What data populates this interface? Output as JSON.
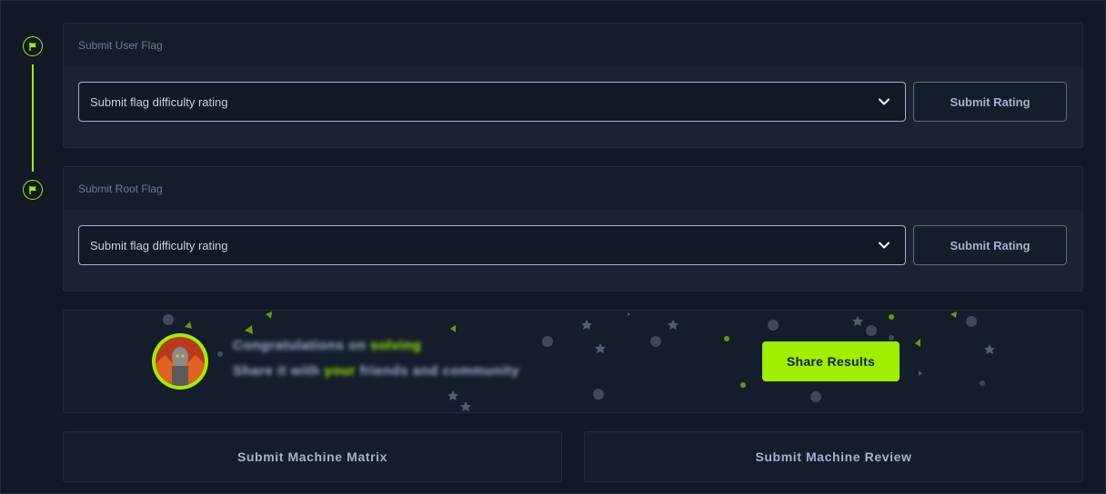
{
  "user_flag": {
    "title": "Submit User Flag",
    "select_value": "Submit flag difficulty rating",
    "submit_label": "Submit Rating"
  },
  "root_flag": {
    "title": "Submit Root Flag",
    "select_value": "Submit flag difficulty rating",
    "submit_label": "Submit Rating"
  },
  "share": {
    "line1_a": "Congratulations on",
    "line1_b": "solving",
    "line2_a": "Share it with",
    "line2_b": "your",
    "line2_c": "friends and community",
    "button_label": "Share Results"
  },
  "bottom": {
    "matrix_label": "Submit Machine Matrix",
    "review_label": "Submit Machine Review"
  },
  "icons": {
    "timeline": "flag-icon",
    "select": "chevron-down-icon"
  },
  "colors": {
    "accent": "#9fef00",
    "background": "#111927",
    "card": "#1a2332",
    "card_header": "#141d2b",
    "text_muted": "#a4b1cd"
  }
}
